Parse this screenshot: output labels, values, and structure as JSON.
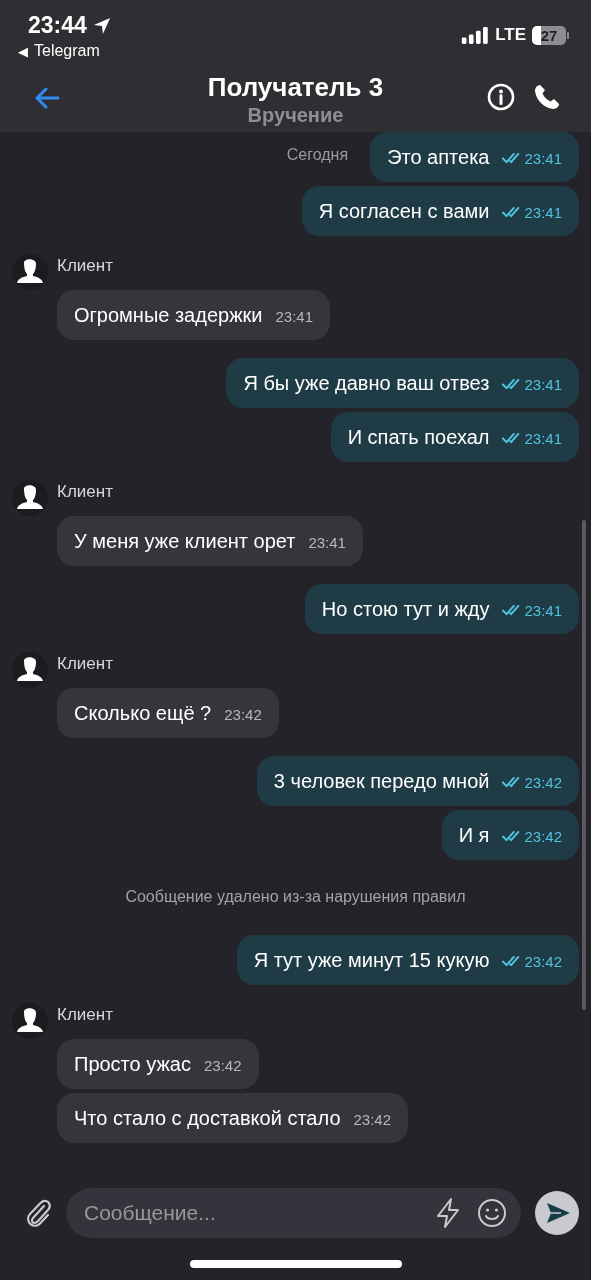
{
  "status_bar": {
    "time": "23:44",
    "back_glyph": "◀",
    "back_app": "Telegram",
    "network": "LTE",
    "battery": "27"
  },
  "header": {
    "title": "Получатель 3",
    "subtitle": "Вручение"
  },
  "groups": [
    {
      "kind": "outgoing",
      "date_label": "Сегодня",
      "messages": [
        {
          "text": "Это аптека",
          "time": "23:41",
          "read": true
        },
        {
          "text": "Я согласен с вами",
          "time": "23:41",
          "read": true
        }
      ]
    },
    {
      "kind": "incoming",
      "sender": "Клиент",
      "messages": [
        {
          "text": "Огромные задержки",
          "time": "23:41"
        }
      ]
    },
    {
      "kind": "outgoing",
      "messages": [
        {
          "text": "Я бы уже давно ваш отвез",
          "time": "23:41",
          "read": true
        },
        {
          "text": "И спать поехал",
          "time": "23:41",
          "read": true
        }
      ]
    },
    {
      "kind": "incoming",
      "sender": "Клиент",
      "messages": [
        {
          "text": "У меня уже клиент орет",
          "time": "23:41"
        }
      ]
    },
    {
      "kind": "outgoing",
      "messages": [
        {
          "text": "Но стою тут и жду",
          "time": "23:41",
          "read": true
        }
      ]
    },
    {
      "kind": "incoming",
      "sender": "Клиент",
      "messages": [
        {
          "text": "Сколько ещё ?",
          "time": "23:42"
        }
      ]
    },
    {
      "kind": "outgoing",
      "messages": [
        {
          "text": "3 человек передо мной",
          "time": "23:42",
          "read": true
        },
        {
          "text": "И я",
          "time": "23:42",
          "read": true
        }
      ]
    },
    {
      "kind": "notice",
      "text": "Сообщение удалено из-за нарушения правил"
    },
    {
      "kind": "outgoing",
      "messages": [
        {
          "text": "Я тут уже минут 15 кукую",
          "time": "23:42",
          "read": true
        }
      ]
    },
    {
      "kind": "incoming",
      "sender": "Клиент",
      "messages": [
        {
          "text": "Просто ужас",
          "time": "23:42"
        },
        {
          "text": "Что стало с доставкой стало",
          "time": "23:42"
        }
      ]
    }
  ],
  "composer": {
    "placeholder": "Сообщение..."
  }
}
